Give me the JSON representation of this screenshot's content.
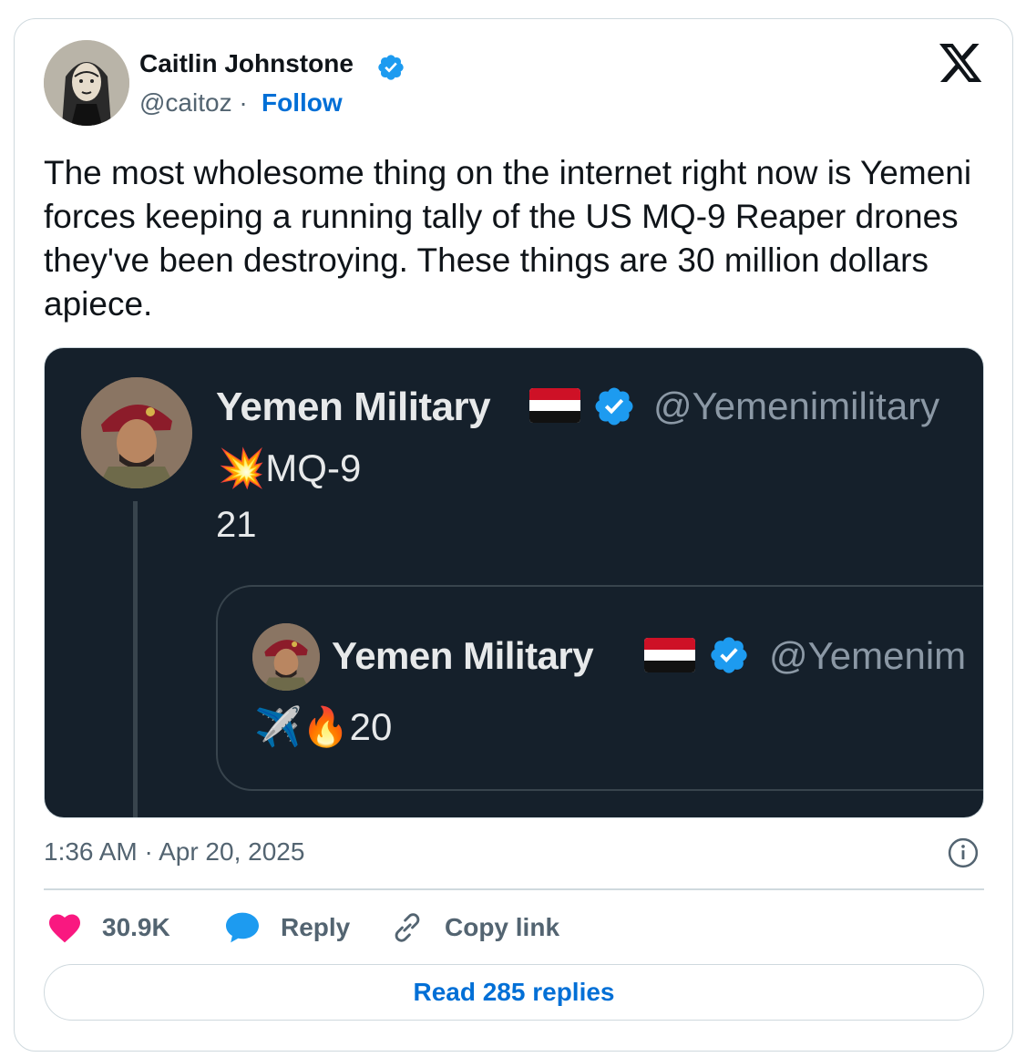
{
  "author": {
    "name": "Caitlin Johnstone",
    "handle": "@caitoz",
    "separator": "·",
    "follow_label": "Follow"
  },
  "tweet": {
    "text": "The most wholesome thing on the internet right now is Yemeni forces keeping a running tally of the US MQ-9 Reaper drones they've been destroying. These things are 30 million dollars apiece.",
    "timestamp": "1:36 AM · Apr 20, 2025"
  },
  "embedded": {
    "name": "Yemen Military",
    "handle": "@Yemenimilitary",
    "line1_emoji": "💥",
    "line1_text": "MQ-9",
    "line2_text": "21",
    "quote": {
      "name": "Yemen Military",
      "handle": "@Yemenim",
      "emoji_plane": "✈️",
      "emoji_fire": "🔥",
      "count": "20"
    }
  },
  "actions": {
    "like_count": "30.9K",
    "reply_label": "Reply",
    "copy_label": "Copy link",
    "read_replies_label": "Read 285 replies"
  },
  "colors": {
    "link_blue": "#006fd6",
    "verified_blue": "#1d9bf0",
    "heart_pink": "#f91880",
    "dark_bg": "#15202b"
  },
  "icons": [
    "verified-badge-icon",
    "x-logo-icon",
    "info-icon",
    "heart-icon",
    "reply-bubble-icon",
    "link-icon",
    "yemen-flag-icon"
  ]
}
